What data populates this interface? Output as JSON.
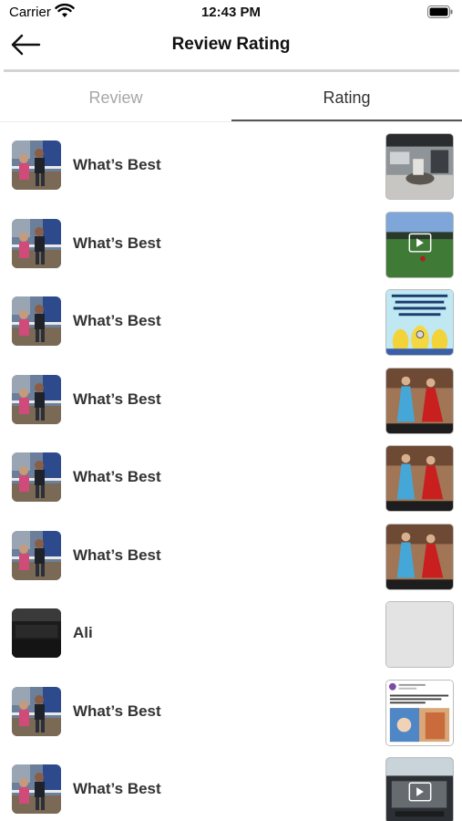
{
  "status_bar": {
    "carrier": "Carrier",
    "time": "12:43 PM"
  },
  "nav": {
    "title": "Review Rating",
    "back_icon": "arrow-left-icon"
  },
  "tabs": [
    {
      "label": "Review",
      "selected": false
    },
    {
      "label": "Rating",
      "selected": true
    }
  ],
  "colors": {
    "tab_inactive": "#a6a6a6",
    "tab_active": "#333333",
    "divider": "#d4d4d4"
  },
  "ratings": [
    {
      "name": "What’s Best",
      "avatar": "family-photo",
      "media": "office-photo"
    },
    {
      "name": "What’s Best",
      "avatar": "family-photo",
      "media": "field-video"
    },
    {
      "name": "What’s Best",
      "avatar": "family-photo",
      "media": "minions-quote"
    },
    {
      "name": "What’s Best",
      "avatar": "family-photo",
      "media": "dancing-girls"
    },
    {
      "name": "What’s Best",
      "avatar": "family-photo",
      "media": "dancing-girls"
    },
    {
      "name": "What’s Best",
      "avatar": "family-photo",
      "media": "dancing-girls"
    },
    {
      "name": "Ali",
      "avatar": "dark-room-photo",
      "media": "blank"
    },
    {
      "name": "What’s Best",
      "avatar": "family-photo",
      "media": "social-post"
    },
    {
      "name": "What’s Best",
      "avatar": "family-photo",
      "media": "car-video"
    }
  ]
}
